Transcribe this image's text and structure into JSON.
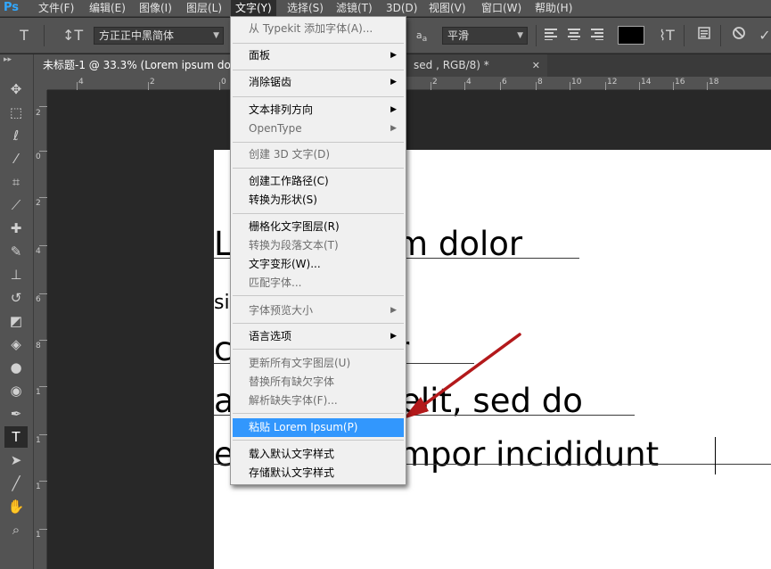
{
  "menubar": {
    "logo": "Ps",
    "items": [
      {
        "label": "文件(F)"
      },
      {
        "label": "编辑(E)"
      },
      {
        "label": "图像(I)"
      },
      {
        "label": "图层(L)"
      },
      {
        "label": "文字(Y)"
      },
      {
        "label": "选择(S)"
      },
      {
        "label": "滤镜(T)"
      },
      {
        "label": "3D(D)"
      },
      {
        "label": "视图(V)"
      },
      {
        "label": "窗口(W)"
      },
      {
        "label": "帮助(H)"
      }
    ]
  },
  "options": {
    "tool_icon": "type-tool-icon",
    "font_family": "方正正中黑简体",
    "antialias": "平滑",
    "color": "#000000"
  },
  "tabs": [
    {
      "label": "未标题-1 @ 33.3% (Lorem ipsum dolor"
    },
    {
      "label": "sed , RGB/8) *"
    }
  ],
  "ruler_top": [
    "4",
    "2",
    "0",
    "2",
    "4",
    "6",
    "8",
    "10",
    "12",
    "14",
    "16",
    "18"
  ],
  "ruler_left": [
    "2",
    "0",
    "2",
    "4",
    "6",
    "8",
    "1",
    "1",
    "1",
    "1"
  ],
  "canvas": {
    "lines": [
      "Lorem ipsum dolor",
      "sit amet,",
      "consectetur",
      "adipisicing elit, sed do",
      "eiusmod tempor incididunt"
    ]
  },
  "menu": {
    "items": [
      {
        "label": "从 Typekit 添加字体(A)...",
        "disabled": true
      },
      {
        "label": "面板",
        "submenu": true
      },
      {
        "label": "消除锯齿",
        "submenu": true
      },
      {
        "label": "文本排列方向",
        "submenu": true
      },
      {
        "label": "OpenType",
        "submenu": true,
        "disabled": true
      },
      {
        "label": "创建 3D 文字(D)",
        "disabled": true
      },
      {
        "label": "创建工作路径(C)"
      },
      {
        "label": "转换为形状(S)"
      },
      {
        "label": "栅格化文字图层(R)"
      },
      {
        "label": "转换为段落文本(T)",
        "disabled": true
      },
      {
        "label": "文字变形(W)..."
      },
      {
        "label": "匹配字体...",
        "disabled": true
      },
      {
        "label": "字体预览大小",
        "submenu": true,
        "disabled": true
      },
      {
        "label": "语言选项",
        "submenu": true
      },
      {
        "label": "更新所有文字图层(U)",
        "disabled": true
      },
      {
        "label": "替换所有缺欠字体",
        "disabled": true
      },
      {
        "label": "解析缺失字体(F)...",
        "disabled": true
      },
      {
        "label": "粘贴 Lorem Ipsum(P)",
        "highlighted": true
      },
      {
        "label": "载入默认文字样式"
      },
      {
        "label": "存储默认文字样式"
      }
    ]
  },
  "colors": {
    "accent": "#3297fd",
    "arrow": "#b3191b"
  }
}
